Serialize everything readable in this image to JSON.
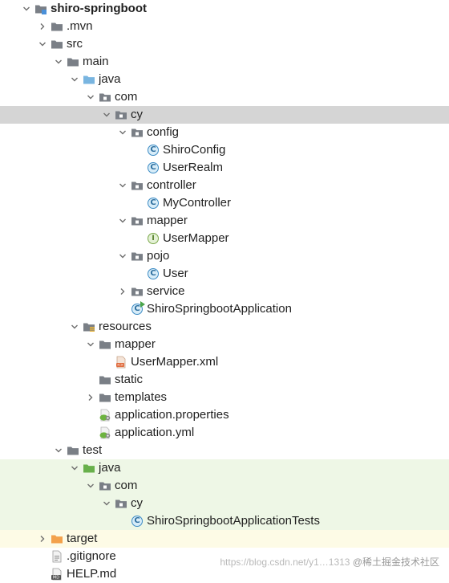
{
  "colors": {
    "selected_row": "#d5d5d5",
    "test_row": "#eef7e6",
    "excluded_row": "#fdfbe6",
    "folder": "#7a7f86",
    "source_root": "#79b5e0",
    "test_root": "#68b04b",
    "excluded_folder": "#f3a14b",
    "class_icon": "#3c8bc4"
  },
  "tree": [
    {
      "label": "shiro-springboot",
      "icon": "module-folder-icon",
      "toggle": "expanded",
      "bold": true
    },
    {
      "label": ".mvn",
      "icon": "folder-icon",
      "toggle": "collapsed"
    },
    {
      "label": "src",
      "icon": "folder-icon",
      "toggle": "expanded"
    },
    {
      "label": "main",
      "icon": "folder-icon",
      "toggle": "expanded"
    },
    {
      "label": "java",
      "icon": "source-root-folder-icon",
      "toggle": "expanded"
    },
    {
      "label": "com",
      "icon": "package-icon",
      "toggle": "expanded"
    },
    {
      "label": "cy",
      "icon": "package-icon",
      "toggle": "expanded",
      "selected": true
    },
    {
      "label": "config",
      "icon": "package-icon",
      "toggle": "expanded"
    },
    {
      "label": "ShiroConfig",
      "icon": "java-class-icon",
      "toggle": "none"
    },
    {
      "label": "UserRealm",
      "icon": "java-class-icon",
      "toggle": "none"
    },
    {
      "label": "controller",
      "icon": "package-icon",
      "toggle": "expanded"
    },
    {
      "label": "MyController",
      "icon": "java-class-icon",
      "toggle": "none"
    },
    {
      "label": "mapper",
      "icon": "package-icon",
      "toggle": "expanded"
    },
    {
      "label": "UserMapper",
      "icon": "java-interface-icon",
      "toggle": "none"
    },
    {
      "label": "pojo",
      "icon": "package-icon",
      "toggle": "expanded"
    },
    {
      "label": "User",
      "icon": "java-class-icon",
      "toggle": "none"
    },
    {
      "label": "service",
      "icon": "package-icon",
      "toggle": "collapsed"
    },
    {
      "label": "ShiroSpringbootApplication",
      "icon": "spring-boot-class-icon",
      "toggle": "none"
    },
    {
      "label": "resources",
      "icon": "resources-root-folder-icon",
      "toggle": "expanded"
    },
    {
      "label": "mapper",
      "icon": "folder-icon",
      "toggle": "expanded"
    },
    {
      "label": "UserMapper.xml",
      "icon": "xml-file-icon",
      "toggle": "none"
    },
    {
      "label": "static",
      "icon": "folder-icon",
      "toggle": "none"
    },
    {
      "label": "templates",
      "icon": "folder-icon",
      "toggle": "collapsed"
    },
    {
      "label": "application.properties",
      "icon": "spring-config-file-icon",
      "toggle": "none"
    },
    {
      "label": "application.yml",
      "icon": "spring-config-file-icon",
      "toggle": "none"
    },
    {
      "label": "test",
      "icon": "folder-icon",
      "toggle": "expanded"
    },
    {
      "label": "java",
      "icon": "test-root-folder-icon",
      "toggle": "expanded",
      "bg": "test"
    },
    {
      "label": "com",
      "icon": "package-icon",
      "toggle": "expanded",
      "bg": "test"
    },
    {
      "label": "cy",
      "icon": "package-icon",
      "toggle": "expanded",
      "bg": "test"
    },
    {
      "label": "ShiroSpringbootApplicationTests",
      "icon": "java-class-icon",
      "toggle": "none",
      "bg": "test"
    },
    {
      "label": "target",
      "icon": "excluded-folder-icon",
      "toggle": "collapsed",
      "bg": "excluded"
    },
    {
      "label": ".gitignore",
      "icon": "text-file-icon",
      "toggle": "none"
    },
    {
      "label": "HELP.md",
      "icon": "markdown-file-icon",
      "toggle": "none"
    }
  ],
  "watermark": {
    "url": "https://blog.csdn.net/y1…1313",
    "brand": "@稀土掘金技术社区"
  }
}
